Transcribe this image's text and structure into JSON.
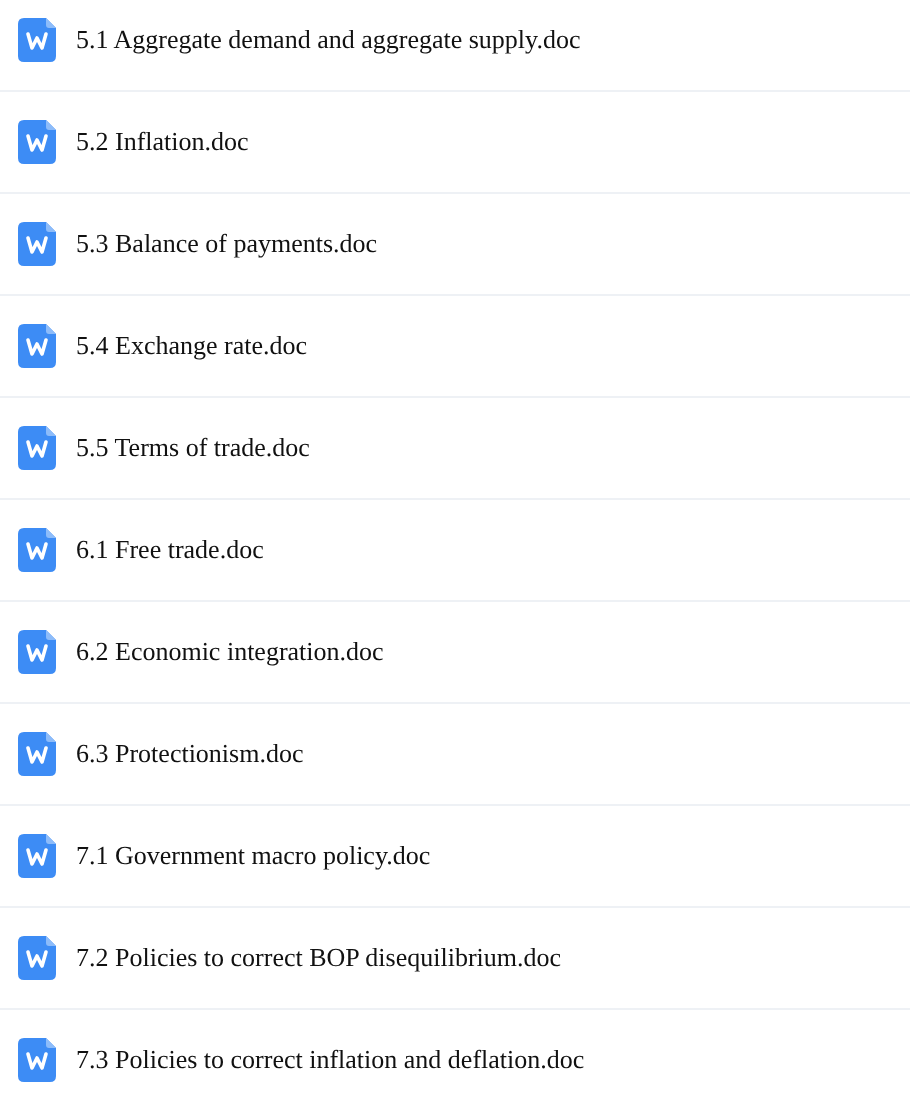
{
  "files": [
    {
      "name": "5.1 Aggregate demand and aggregate supply.doc"
    },
    {
      "name": "5.2 Inflation.doc"
    },
    {
      "name": "5.3 Balance of payments.doc"
    },
    {
      "name": "5.4 Exchange rate.doc"
    },
    {
      "name": "5.5 Terms of trade.doc"
    },
    {
      "name": "6.1 Free trade.doc"
    },
    {
      "name": "6.2 Economic integration.doc"
    },
    {
      "name": "6.3 Protectionism.doc"
    },
    {
      "name": "7.1 Government macro policy.doc"
    },
    {
      "name": "7.2 Policies to correct BOP disequilibrium.doc"
    },
    {
      "name": "7.3 Policies to correct inflation and deflation.doc"
    }
  ]
}
